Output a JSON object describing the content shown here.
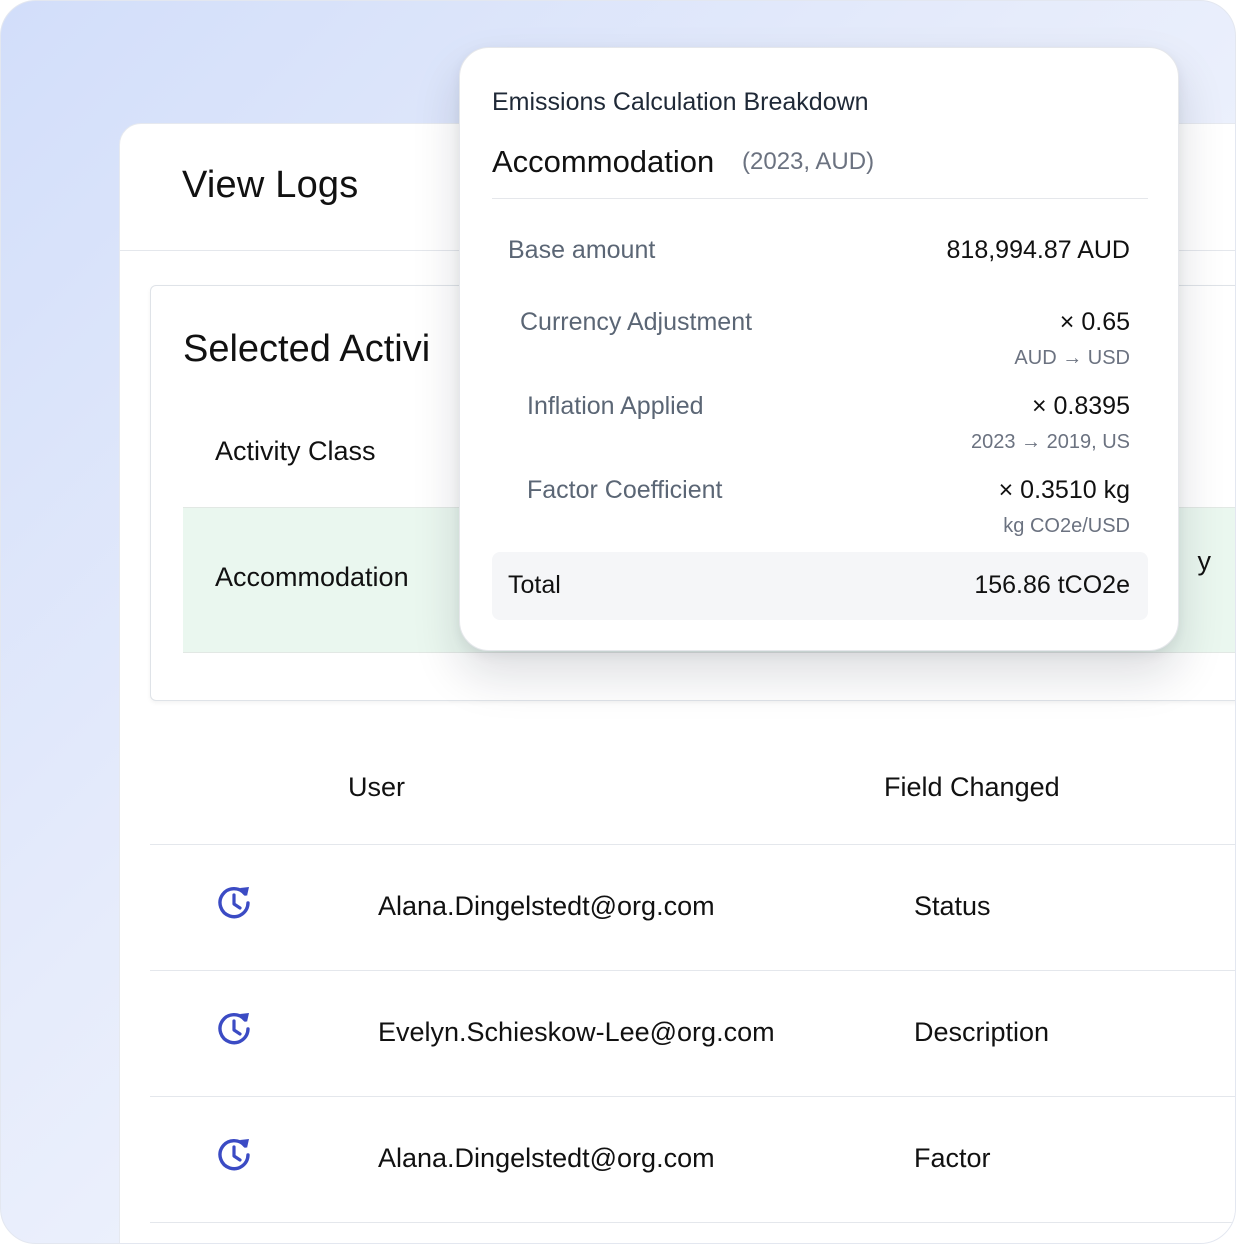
{
  "page": {
    "title": "View Logs"
  },
  "selected_activity": {
    "title": "Selected Activi",
    "column_label": "Activity Class",
    "row_value": "Accommodation",
    "row_tail": "y"
  },
  "table": {
    "headers": {
      "user": "User",
      "field_changed": "Field Changed"
    },
    "rows": [
      {
        "user": "Alana.Dingelstedt@org.com",
        "field": "Status"
      },
      {
        "user": "Evelyn.Schieskow-Lee@org.com",
        "field": "Description"
      },
      {
        "user": "Alana.Dingelstedt@org.com",
        "field": "Factor"
      }
    ],
    "row_icon": "history-clock-icon"
  },
  "breakdown": {
    "subtitle": "Emissions Calculation Breakdown",
    "title": "Accommodation",
    "meta": "(2023, AUD)",
    "base": {
      "label": "Base amount",
      "value": "818,994.87 AUD"
    },
    "currency": {
      "label": "Currency Adjustment",
      "value": "× 0.65",
      "note": "AUD → USD"
    },
    "inflation": {
      "label": "Inflation Applied",
      "value": "× 0.8395",
      "note": "2023 → 2019, US"
    },
    "factor": {
      "label": "Factor Coefficient",
      "value": "× 0.3510 kg",
      "note": "kg CO2e/USD"
    },
    "total": {
      "label": "Total",
      "value": "156.86 tCO2e"
    }
  },
  "colors": {
    "accent": "#3b4bc4",
    "highlight_row": "#eaf7ef"
  }
}
